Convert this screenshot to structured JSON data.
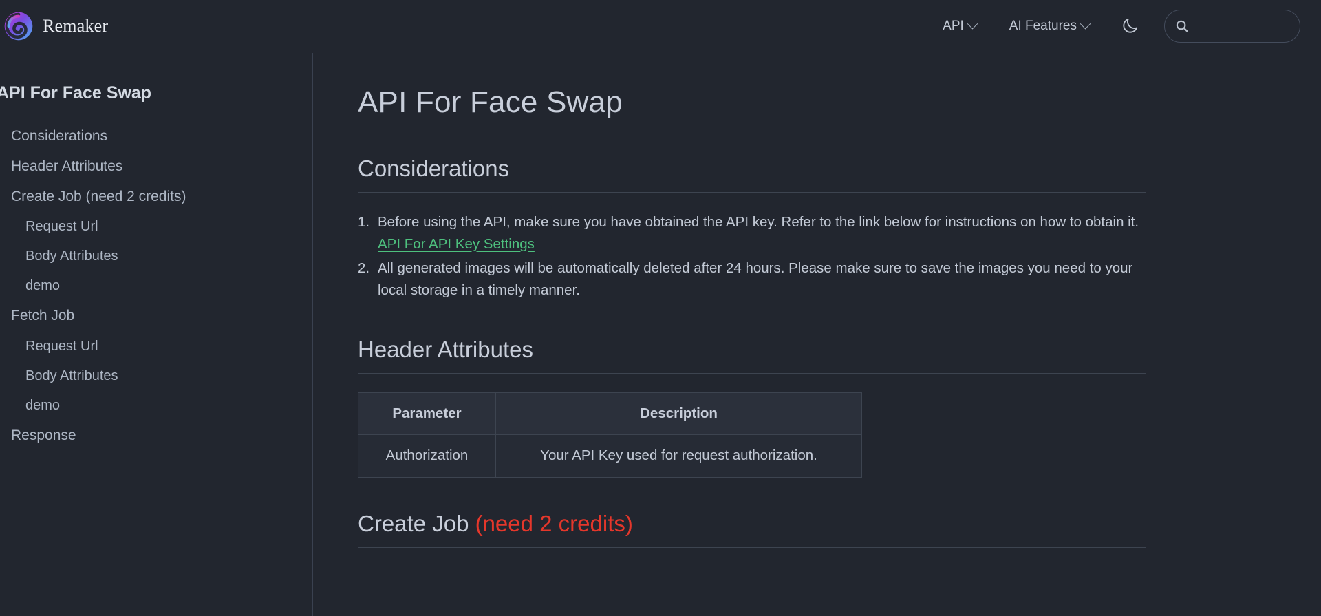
{
  "header": {
    "brand": {
      "name": "Remaker",
      "logo_icon": "swirl-logo-icon",
      "gradient_from": "#c33bd6",
      "gradient_to": "#4aa8f0"
    },
    "nav": [
      {
        "label": "API",
        "has_dropdown": true
      },
      {
        "label": "AI Features",
        "has_dropdown": true
      }
    ],
    "theme_toggle": {
      "icon": "moon-icon",
      "state": "dark"
    },
    "search": {
      "icon": "search-icon",
      "value": "",
      "placeholder": ""
    }
  },
  "sidebar": {
    "title": "API For Face Swap",
    "items": [
      {
        "label": "Considerations",
        "level": 1
      },
      {
        "label": "Header Attributes",
        "level": 1
      },
      {
        "label": "Create Job (need 2 credits)",
        "level": 1
      },
      {
        "label": "Request Url",
        "level": 2
      },
      {
        "label": "Body Attributes",
        "level": 2
      },
      {
        "label": "demo",
        "level": 2
      },
      {
        "label": "Fetch Job",
        "level": 1
      },
      {
        "label": "Request Url",
        "level": 2
      },
      {
        "label": "Body Attributes",
        "level": 2
      },
      {
        "label": "demo",
        "level": 2
      },
      {
        "label": "Response",
        "level": 1
      }
    ]
  },
  "main": {
    "title": "API For Face Swap",
    "considerations": {
      "heading": "Considerations",
      "items": [
        {
          "text_before": "Before using the API, make sure you have obtained the API key. Refer to the link below for instructions on how to obtain it. ",
          "link": "API For API Key Settings",
          "text_after": ""
        },
        {
          "text_before": "All generated images will be automatically deleted after 24 hours. Please make sure to save the images you need to your local storage in a timely manner.",
          "link": "",
          "text_after": ""
        }
      ]
    },
    "header_attributes": {
      "heading": "Header Attributes",
      "columns": [
        "Parameter",
        "Description"
      ],
      "rows": [
        [
          "Authorization",
          "Your API Key used for request authorization."
        ]
      ]
    },
    "create_job": {
      "heading_main": "Create Job ",
      "heading_accent": "(need 2 credits)",
      "accent_color": "#e5372b"
    }
  }
}
